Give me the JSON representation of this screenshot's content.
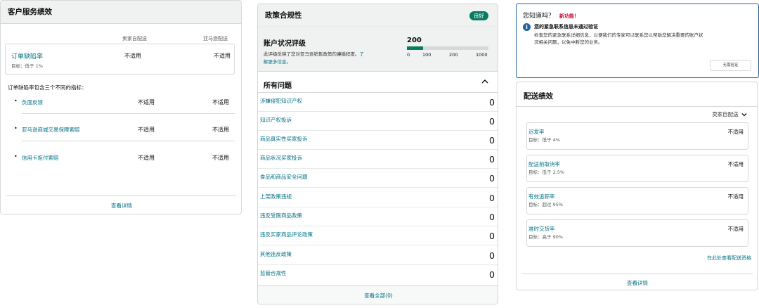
{
  "customer_service": {
    "title": "客户服务绩效",
    "col_fbm": "卖家自配送",
    "col_fba": "亚马逊配送",
    "odr_label": "订单缺陷率",
    "odr_target": "目标：低于 1%",
    "odr_fbm": "不适用",
    "odr_fba": "不适用",
    "intro": "订单缺陷率包含三个不同的指标：",
    "metrics": [
      {
        "label": "负面反馈",
        "fbm": "不适用",
        "fba": "不适用"
      },
      {
        "label": "亚马逊商城交易保障索赔",
        "fbm": "不适用",
        "fba": "不适用"
      },
      {
        "label": "信用卡拒付索赔",
        "fbm": "不适用",
        "fba": "不适用"
      }
    ],
    "view_details": "查看详情"
  },
  "policy": {
    "title": "政策合规性",
    "badge": "良好",
    "badge_color": "#067d62",
    "rating_title": "账户状况评级",
    "rating_desc_1": "此评级反映了您对亚马逊销售政策的遵循程度。",
    "rating_desc_link_a": "了",
    "rating_desc_link_b": "解更多信息。",
    "score": "200",
    "score_fraction": 0.2,
    "ticks": [
      "0",
      "100",
      "200",
      "1000"
    ],
    "all_issues": "所有问题",
    "issues": [
      {
        "label": "涉嫌侵犯知识产权",
        "value": "0"
      },
      {
        "label": "知识产权投诉",
        "value": "0"
      },
      {
        "label": "商品真实性买家投诉",
        "value": "0"
      },
      {
        "label": "商品状况买家投诉",
        "value": "0"
      },
      {
        "label": "食品和商品安全问题",
        "value": "0"
      },
      {
        "label": "上架政策违规",
        "value": "0"
      },
      {
        "label": "违反受限商品政策",
        "value": "0"
      },
      {
        "label": "违反买家商品评论政策",
        "value": "0"
      },
      {
        "label": "其他违反政策",
        "value": "0"
      },
      {
        "label": "监管合规性",
        "value": "0"
      }
    ],
    "view_all": "查看全部(0)"
  },
  "notice": {
    "heading": "您知道吗？",
    "new_feature": "新功能！",
    "info_title": "您的紧急联系信息未通过验证",
    "info_text_1": "检查您的紧急联系详细信息，以便我们的专家可以联系您以帮助您解决重要的账户状",
    "info_text_2": "况相关问题，以免中断您的业务。",
    "button": "无需验证"
  },
  "shipping": {
    "title": "配送绩效",
    "dropdown": "卖家自配送",
    "metrics": [
      {
        "label": "迟发率",
        "target": "目标：低于 4%",
        "value": "不适用"
      },
      {
        "label": "配送前取消率",
        "target": "目标：低于 2.5%",
        "value": "不适用"
      },
      {
        "label": "有效追踪率",
        "target": "目标：超过 95%",
        "value": "不适用"
      },
      {
        "label": "准时交货率",
        "target": "目标：高于 90%",
        "value": "不适用"
      }
    ],
    "eligibility_link": "在此处查看配送资格",
    "view_details": "查看详情"
  }
}
